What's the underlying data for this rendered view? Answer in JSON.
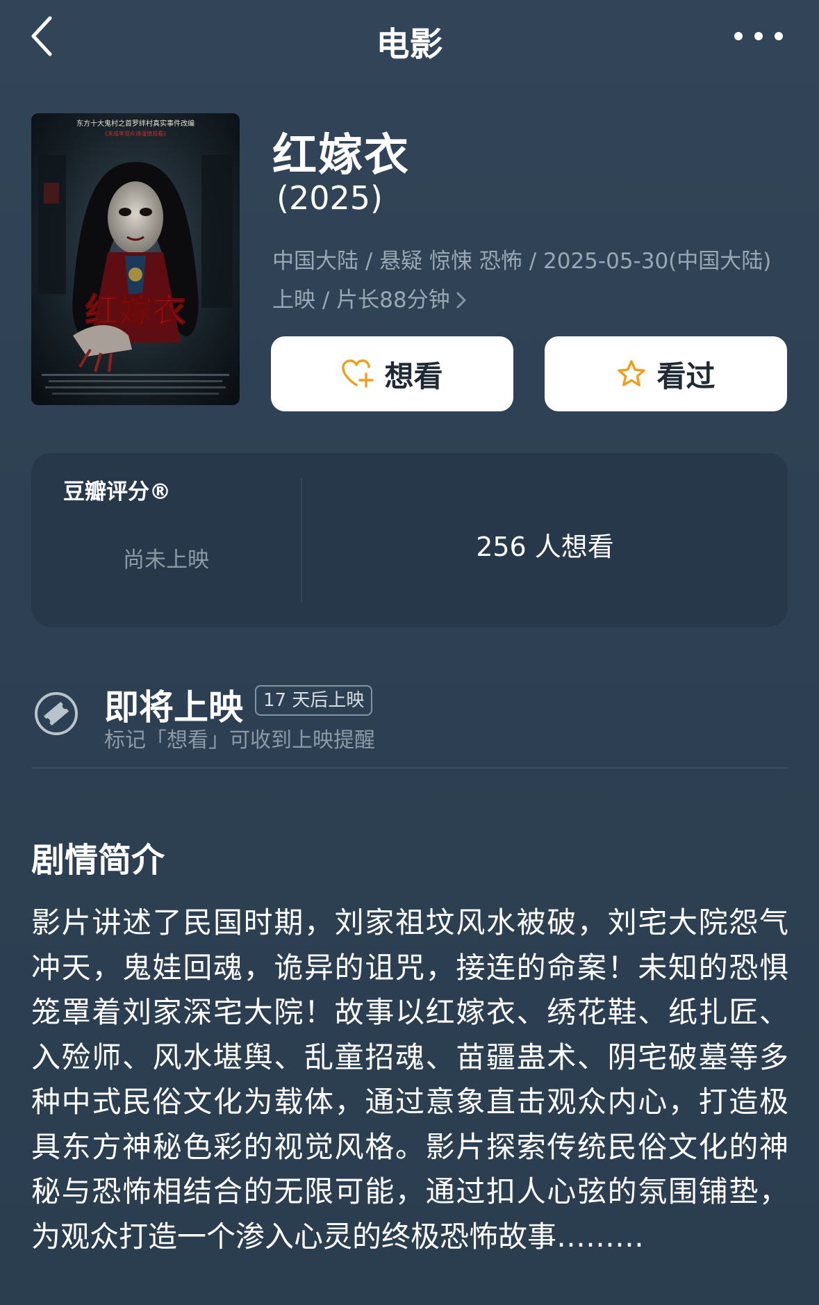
{
  "nav": {
    "title": "电影",
    "back_icon": "chevron-left-icon",
    "more_icon": "more-dots-icon"
  },
  "movie": {
    "title": "红嫁衣",
    "year": "(2025)",
    "meta": "中国大陆 / 悬疑 惊悚 恐怖 / 2025-05-30(中国大陆) 上映 / 片长88分钟",
    "poster": {
      "top_text": "东方十大鬼村之首罗绊村真实事件改编",
      "sub_text": "《未成年观众请谨慎观看》",
      "title_art": "红嫁衣"
    }
  },
  "actions": {
    "want_label": "想看",
    "want_icon": "heart-plus-icon",
    "seen_label": "看过",
    "seen_icon": "star-icon"
  },
  "rating": {
    "label": "豆瓣评分®",
    "value": "尚未上映",
    "want_count": "256 人想看"
  },
  "upcoming": {
    "title": "即将上映",
    "badge": "17 天后上映",
    "subtitle": "标记「想看」可收到上映提醒",
    "icon": "ticket-icon"
  },
  "synopsis": {
    "title": "剧情简介",
    "text": "影片讲述了民国时期，刘家祖坟风水被破，刘宅大院怨气冲天，鬼娃回魂，诡异的诅咒，接连的命案！未知的恐惧笼罩着刘家深宅大院！故事以红嫁衣、绣花鞋、纸扎匠、入殓师、风水堪舆、乱童招魂、苗疆蛊术、阴宅破墓等多种中式民俗文化为载体，通过意象直击观众内心，打造极具东方神秘色彩的视觉风格。影片探索传统民俗文化的神秘与恐怖相结合的无限可能，通过扣人心弦的氛围铺垫，为观众打造一个渗入心灵的终极恐怖故事………"
  },
  "colors": {
    "background": "#2e4154",
    "card": "#26384a",
    "muted_text": "#9aa8b5",
    "accent_orange": "#f0a020",
    "poster_red": "#c4161c"
  }
}
